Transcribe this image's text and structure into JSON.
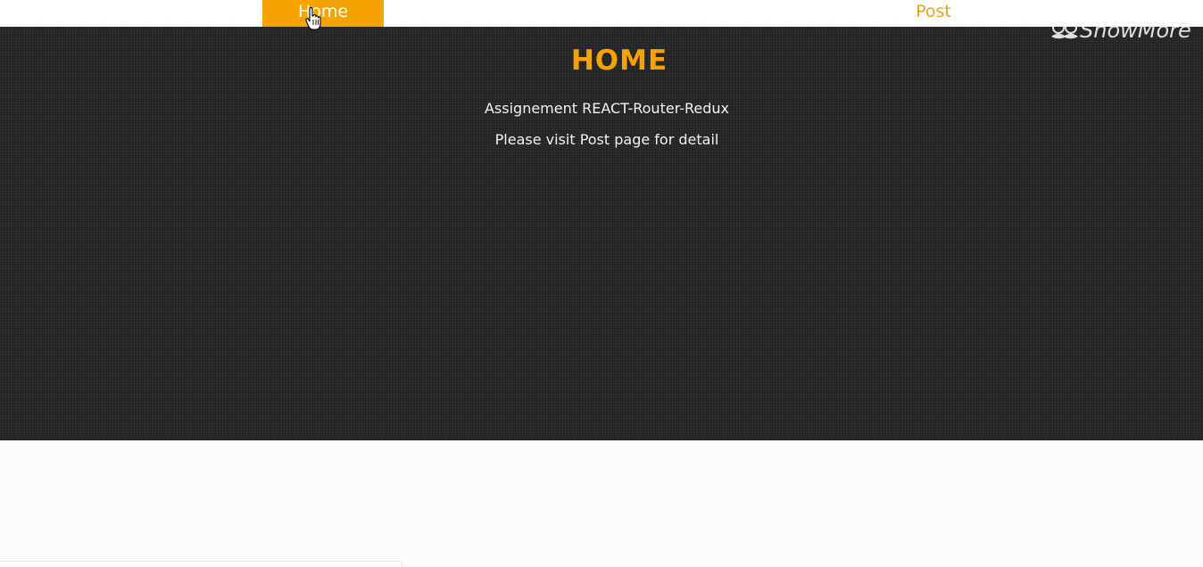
{
  "nav": {
    "items": [
      {
        "label": "Home",
        "active": true
      },
      {
        "label": "Post",
        "active": false
      }
    ],
    "active_color": "#f5a300",
    "link_color": "#e9a21e"
  },
  "hero": {
    "title": "HOME",
    "lines": [
      "Assignement REACT-Router-Redux",
      "Please visit Post page for detail"
    ],
    "title_color": "#f5a300",
    "background_color": "#232323"
  },
  "watermark": {
    "text": "ShowMore",
    "icon": "mustache-logo-icon"
  },
  "cursor": {
    "icon": "hand-pointer-icon"
  }
}
